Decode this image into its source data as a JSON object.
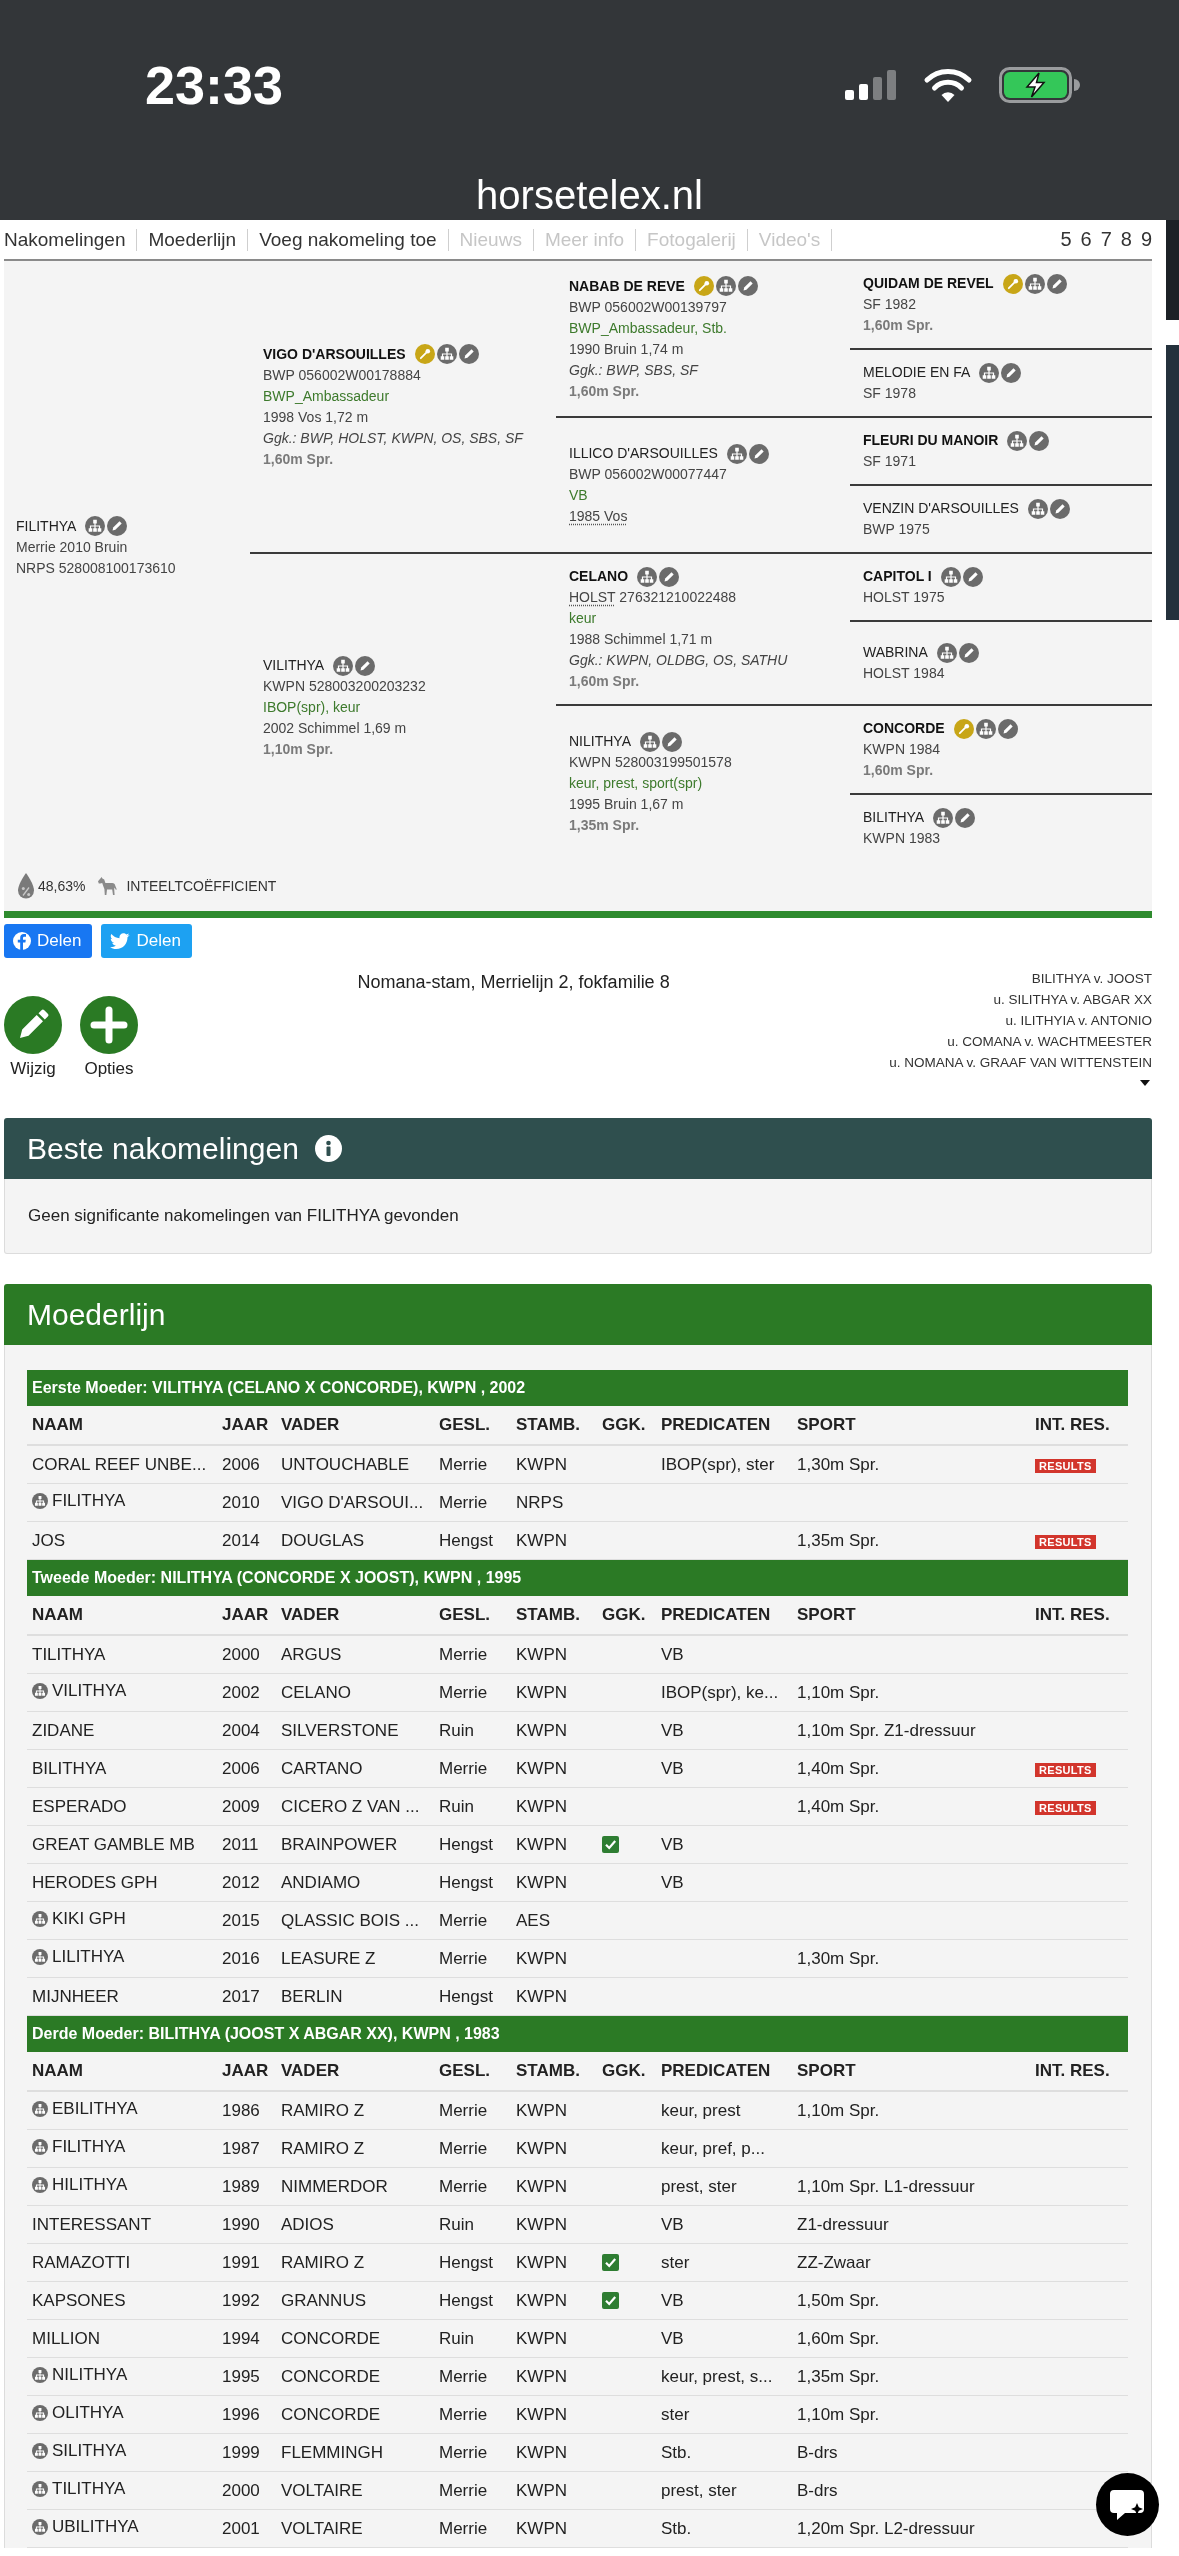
{
  "status_bar": {
    "time": "23:33"
  },
  "browser": {
    "url": "horsetelex.nl"
  },
  "nav": {
    "links": [
      {
        "label": "Nakomelingen",
        "disabled": false
      },
      {
        "label": "Moederlijn",
        "disabled": false
      },
      {
        "label": "Voeg nakomeling toe",
        "disabled": false
      },
      {
        "label": "Nieuws",
        "disabled": true
      },
      {
        "label": "Meer info",
        "disabled": true
      },
      {
        "label": "Fotogalerij",
        "disabled": true
      },
      {
        "label": "Video's",
        "disabled": true
      }
    ],
    "generations": [
      "5",
      "6",
      "7",
      "8",
      "9"
    ]
  },
  "pedigree": {
    "horse": {
      "name": "FILITHYA",
      "highlighted": false,
      "award": false,
      "lines": [
        {
          "kind": "details",
          "text": "Merrie 2010 Bruin",
          "dotted": false
        },
        {
          "kind": "registration",
          "studbook": "NRPS",
          "text": "528008100173610",
          "dotted": false
        }
      ],
      "parents": [
        {
          "name": "VIGO D'ARSOUILLES",
          "highlighted": true,
          "award": true,
          "lines": [
            {
              "kind": "registration",
              "studbook": "BWP",
              "text": "056002W00178884",
              "dotted": false
            },
            {
              "kind": "predicates",
              "text": "BWP_Ambassadeur",
              "dotted": false
            },
            {
              "kind": "details",
              "text": "1998 Vos 1,72 m",
              "dotted": false
            },
            {
              "kind": "studbooks",
              "text": "Ggk.: BWP, HOLST, KWPN, OS, SBS, SF",
              "dotted": false
            },
            {
              "kind": "sport",
              "text": "1,60m Spr.",
              "dotted": false
            }
          ],
          "parents": [
            {
              "name": "NABAB DE REVE",
              "highlighted": true,
              "award": true,
              "lines": [
                {
                  "kind": "registration",
                  "studbook": "BWP",
                  "text": "056002W00139797",
                  "dotted": false
                },
                {
                  "kind": "predicates",
                  "text": "BWP_Ambassadeur, Stb.",
                  "dotted": false
                },
                {
                  "kind": "details",
                  "text": "1990 Bruin 1,74 m",
                  "dotted": false
                },
                {
                  "kind": "studbooks",
                  "text": "Ggk.: BWP, SBS, SF",
                  "dotted": false
                },
                {
                  "kind": "sport",
                  "text": "1,60m Spr.",
                  "dotted": false
                }
              ],
              "parents": [
                {
                  "name": "QUIDAM DE REVEL",
                  "highlighted": true,
                  "award": true,
                  "lines": [
                    {
                      "kind": "registration",
                      "studbook": "SF",
                      "text": "1982",
                      "dotted": false
                    },
                    {
                      "kind": "sport",
                      "text": "1,60m Spr.",
                      "dotted": false
                    }
                  ]
                },
                {
                  "name": "MELODIE EN FA",
                  "highlighted": false,
                  "award": false,
                  "lines": [
                    {
                      "kind": "registration",
                      "studbook": "SF",
                      "text": "1978",
                      "dotted": false
                    }
                  ]
                }
              ]
            },
            {
              "name": "ILLICO D'ARSOUILLES",
              "highlighted": false,
              "award": false,
              "lines": [
                {
                  "kind": "registration",
                  "studbook": "BWP",
                  "text": "056002W00077447",
                  "dotted": false
                },
                {
                  "kind": "predicates",
                  "text": "VB",
                  "dotted": false
                },
                {
                  "kind": "details",
                  "text": "1985 Vos",
                  "dotted": true
                }
              ],
              "parents": [
                {
                  "name": "FLEURI DU MANOIR",
                  "highlighted": true,
                  "award": false,
                  "lines": [
                    {
                      "kind": "registration",
                      "studbook": "SF",
                      "text": "1971",
                      "dotted": false
                    }
                  ]
                },
                {
                  "name": "VENZIN D'ARSOUILLES",
                  "highlighted": false,
                  "award": false,
                  "lines": [
                    {
                      "kind": "registration",
                      "studbook": "BWP",
                      "text": "1975",
                      "dotted": false
                    }
                  ]
                }
              ]
            }
          ]
        },
        {
          "name": "VILITHYA",
          "highlighted": false,
          "award": false,
          "lines": [
            {
              "kind": "registration",
              "studbook": "KWPN",
              "text": "528003200203232",
              "dotted": false
            },
            {
              "kind": "predicates",
              "text": "IBOP(spr), keur",
              "dotted": false
            },
            {
              "kind": "details",
              "text": "2002 Schimmel 1,69 m",
              "dotted": false
            },
            {
              "kind": "sport",
              "text": "1,10m Spr.",
              "dotted": false
            }
          ],
          "parents": [
            {
              "name": "CELANO",
              "highlighted": true,
              "award": false,
              "lines": [
                {
                  "kind": "registration",
                  "studbook": "HOLST",
                  "text": "276321210022488",
                  "dotted": true
                },
                {
                  "kind": "predicates",
                  "text": "keur",
                  "dotted": false
                },
                {
                  "kind": "details",
                  "text": "1988 Schimmel 1,71 m",
                  "dotted": false
                },
                {
                  "kind": "studbooks",
                  "text": "Ggk.: KWPN, OLDBG, OS, SATHU",
                  "dotted": false
                },
                {
                  "kind": "sport",
                  "text": "1,60m Spr.",
                  "dotted": false
                }
              ],
              "parents": [
                {
                  "name": "CAPITOL I",
                  "highlighted": true,
                  "award": false,
                  "lines": [
                    {
                      "kind": "registration",
                      "studbook": "HOLST",
                      "text": "1975",
                      "dotted": false
                    }
                  ]
                },
                {
                  "name": "WABRINA",
                  "highlighted": false,
                  "award": false,
                  "lines": [
                    {
                      "kind": "registration",
                      "studbook": "HOLST",
                      "text": "1984",
                      "dotted": false
                    }
                  ]
                }
              ]
            },
            {
              "name": "NILITHYA",
              "highlighted": false,
              "award": false,
              "lines": [
                {
                  "kind": "registration",
                  "studbook": "KWPN",
                  "text": "528003199501578",
                  "dotted": false
                },
                {
                  "kind": "predicates",
                  "text": "keur, prest, sport(spr)",
                  "dotted": false
                },
                {
                  "kind": "details",
                  "text": "1995 Bruin 1,67 m",
                  "dotted": false
                },
                {
                  "kind": "sport",
                  "text": "1,35m Spr.",
                  "dotted": false
                }
              ],
              "parents": [
                {
                  "name": "CONCORDE",
                  "highlighted": true,
                  "award": true,
                  "lines": [
                    {
                      "kind": "registration",
                      "studbook": "KWPN",
                      "text": "1984",
                      "dotted": false
                    },
                    {
                      "kind": "sport",
                      "text": "1,60m Spr.",
                      "dotted": false
                    }
                  ]
                },
                {
                  "name": "BILITHYA",
                  "highlighted": false,
                  "award": false,
                  "lines": [
                    {
                      "kind": "registration",
                      "studbook": "KWPN",
                      "text": "1983",
                      "dotted": false
                    }
                  ]
                }
              ]
            }
          ]
        }
      ]
    },
    "inbreeding": {
      "value": "48,63%",
      "label": "INTEELTCOËFFICIENT"
    }
  },
  "share_buttons": [
    {
      "kind": "facebook",
      "label": "Delen"
    },
    {
      "kind": "twitter",
      "label": "Delen"
    }
  ],
  "actions": [
    {
      "kind": "edit",
      "label": "Wijzig"
    },
    {
      "kind": "add",
      "label": "Opties"
    }
  ],
  "family": {
    "title": "Nomana-stam, Merrielijn 2, fokfamilie 8",
    "lineage": [
      "BILITHYA v. JOOST",
      "u. SILITHYA v. ABGAR XX",
      "u. ILITHYIA v. ANTONIO",
      "u. COMANA v. WACHTMEESTER",
      "u. NOMANA v. GRAAF VAN WITTENSTEIN"
    ]
  },
  "best_offspring": {
    "title": "Beste nakomelingen",
    "message": "Geen significante nakomelingen van FILITHYA gevonden"
  },
  "dam_line": {
    "title": "Moederlijn",
    "sections": [
      {
        "title": "Eerste Moeder: VILITHYA (CELANO X CONCORDE), KWPN , 2002",
        "columns": [
          "NAAM",
          "JAAR",
          "VADER",
          "GESL.",
          "STAMB.",
          "GGK.",
          "PREDICATEN",
          "SPORT",
          "INT. RES."
        ],
        "rows": [
          {
            "name": "CORAL REEF UNBE...",
            "family_icon": false,
            "year": "2006",
            "sire": "UNTOUCHABLE",
            "sex": "Merrie",
            "studbook": "KWPN",
            "ggk": false,
            "predicates": "IBOP(spr), ster",
            "sport": "1,30m Spr.",
            "int_res": "RESULTS"
          },
          {
            "name": "FILITHYA",
            "family_icon": true,
            "year": "2010",
            "sire": "VIGO D'ARSOUI...",
            "sex": "Merrie",
            "studbook": "NRPS",
            "ggk": false
          },
          {
            "name": "JOS",
            "family_icon": false,
            "year": "2014",
            "sire": "DOUGLAS",
            "sex": "Hengst",
            "studbook": "KWPN",
            "ggk": false,
            "sport": "1,35m Spr.",
            "int_res": "RESULTS"
          }
        ]
      },
      {
        "title": "Tweede Moeder: NILITHYA (CONCORDE X JOOST), KWPN , 1995",
        "columns": [
          "NAAM",
          "JAAR",
          "VADER",
          "GESL.",
          "STAMB.",
          "GGK.",
          "PREDICATEN",
          "SPORT",
          "INT. RES."
        ],
        "rows": [
          {
            "name": "TILITHYA",
            "family_icon": false,
            "year": "2000",
            "sire": "ARGUS",
            "sex": "Merrie",
            "studbook": "KWPN",
            "ggk": false,
            "predicates": "VB"
          },
          {
            "name": "VILITHYA",
            "family_icon": true,
            "year": "2002",
            "sire": "CELANO",
            "sex": "Merrie",
            "studbook": "KWPN",
            "ggk": false,
            "predicates": "IBOP(spr), ke...",
            "sport": "1,10m Spr."
          },
          {
            "name": "ZIDANE",
            "family_icon": false,
            "year": "2004",
            "sire": "SILVERSTONE",
            "sex": "Ruin",
            "studbook": "KWPN",
            "ggk": false,
            "predicates": "VB",
            "sport": "1,10m Spr. Z1-dressuur"
          },
          {
            "name": "BILITHYA",
            "family_icon": false,
            "year": "2006",
            "sire": "CARTANO",
            "sex": "Merrie",
            "studbook": "KWPN",
            "ggk": false,
            "predicates": "VB",
            "sport": "1,40m Spr.",
            "int_res": "RESULTS"
          },
          {
            "name": "ESPERADO",
            "family_icon": false,
            "year": "2009",
            "sire": "CICERO Z VAN ...",
            "sex": "Ruin",
            "studbook": "KWPN",
            "ggk": false,
            "sport": "1,40m Spr.",
            "int_res": "RESULTS"
          },
          {
            "name": "GREAT GAMBLE MB",
            "family_icon": false,
            "year": "2011",
            "sire": "BRAINPOWER",
            "sex": "Hengst",
            "studbook": "KWPN",
            "ggk": true,
            "predicates": "VB"
          },
          {
            "name": "HERODES GPH",
            "family_icon": false,
            "year": "2012",
            "sire": "ANDIAMO",
            "sex": "Hengst",
            "studbook": "KWPN",
            "ggk": false,
            "predicates": "VB"
          },
          {
            "name": "KIKI GPH",
            "family_icon": true,
            "year": "2015",
            "sire": "QLASSIC BOIS ...",
            "sex": "Merrie",
            "studbook": "AES",
            "ggk": false
          },
          {
            "name": "LILITHYA",
            "family_icon": true,
            "year": "2016",
            "sire": "LEASURE Z",
            "sex": "Merrie",
            "studbook": "KWPN",
            "ggk": false,
            "sport": "1,30m Spr."
          },
          {
            "name": "MIJNHEER",
            "family_icon": false,
            "year": "2017",
            "sire": "BERLIN",
            "sex": "Hengst",
            "studbook": "KWPN",
            "ggk": false
          }
        ]
      },
      {
        "title": "Derde Moeder: BILITHYA (JOOST X ABGAR XX), KWPN , 1983",
        "columns": [
          "NAAM",
          "JAAR",
          "VADER",
          "GESL.",
          "STAMB.",
          "GGK.",
          "PREDICATEN",
          "SPORT",
          "INT. RES."
        ],
        "rows": [
          {
            "name": "EBILITHYA",
            "family_icon": true,
            "year": "1986",
            "sire": "RAMIRO Z",
            "sex": "Merrie",
            "studbook": "KWPN",
            "ggk": false,
            "predicates": "keur, prest",
            "sport": "1,10m Spr."
          },
          {
            "name": "FILITHYA",
            "family_icon": true,
            "year": "1987",
            "sire": "RAMIRO Z",
            "sex": "Merrie",
            "studbook": "KWPN",
            "ggk": false,
            "predicates": "keur, pref, p..."
          },
          {
            "name": "HILITHYA",
            "family_icon": true,
            "year": "1989",
            "sire": "NIMMERDOR",
            "sex": "Merrie",
            "studbook": "KWPN",
            "ggk": false,
            "predicates": "prest, ster",
            "sport": "1,10m Spr. L1-dressuur"
          },
          {
            "name": "INTERESSANT",
            "family_icon": false,
            "year": "1990",
            "sire": "ADIOS",
            "sex": "Ruin",
            "studbook": "KWPN",
            "ggk": false,
            "predicates": "VB",
            "sport": "Z1-dressuur"
          },
          {
            "name": "RAMAZOTTI",
            "family_icon": false,
            "year": "1991",
            "sire": "RAMIRO Z",
            "sex": "Hengst",
            "studbook": "KWPN",
            "ggk": true,
            "predicates": "ster",
            "sport": "ZZ-Zwaar"
          },
          {
            "name": "KAPSONES",
            "family_icon": false,
            "year": "1992",
            "sire": "GRANNUS",
            "sex": "Hengst",
            "studbook": "KWPN",
            "ggk": true,
            "predicates": "VB",
            "sport": "1,50m Spr."
          },
          {
            "name": "MILLION",
            "family_icon": false,
            "year": "1994",
            "sire": "CONCORDE",
            "sex": "Ruin",
            "studbook": "KWPN",
            "ggk": false,
            "predicates": "VB",
            "sport": "1,60m Spr."
          },
          {
            "name": "NILITHYA",
            "family_icon": true,
            "year": "1995",
            "sire": "CONCORDE",
            "sex": "Merrie",
            "studbook": "KWPN",
            "ggk": false,
            "predicates": "keur, prest, s...",
            "sport": "1,35m Spr."
          },
          {
            "name": "OLITHYA",
            "family_icon": true,
            "year": "1996",
            "sire": "CONCORDE",
            "sex": "Merrie",
            "studbook": "KWPN",
            "ggk": false,
            "predicates": "ster",
            "sport": "1,10m Spr."
          },
          {
            "name": "SILITHYA",
            "family_icon": true,
            "year": "1999",
            "sire": "FLEMMINGH",
            "sex": "Merrie",
            "studbook": "KWPN",
            "ggk": false,
            "predicates": "Stb.",
            "sport": "B-drs"
          },
          {
            "name": "TILITHYA",
            "family_icon": true,
            "year": "2000",
            "sire": "VOLTAIRE",
            "sex": "Merrie",
            "studbook": "KWPN",
            "ggk": false,
            "predicates": "prest, ster",
            "sport": "B-drs"
          },
          {
            "name": "UBILITHYA",
            "family_icon": true,
            "year": "2001",
            "sire": "VOLTAIRE",
            "sex": "Merrie",
            "studbook": "KWPN",
            "ggk": false,
            "predicates": "Stb.",
            "sport": "1,20m Spr. L2-dressuur"
          }
        ]
      }
    ]
  }
}
